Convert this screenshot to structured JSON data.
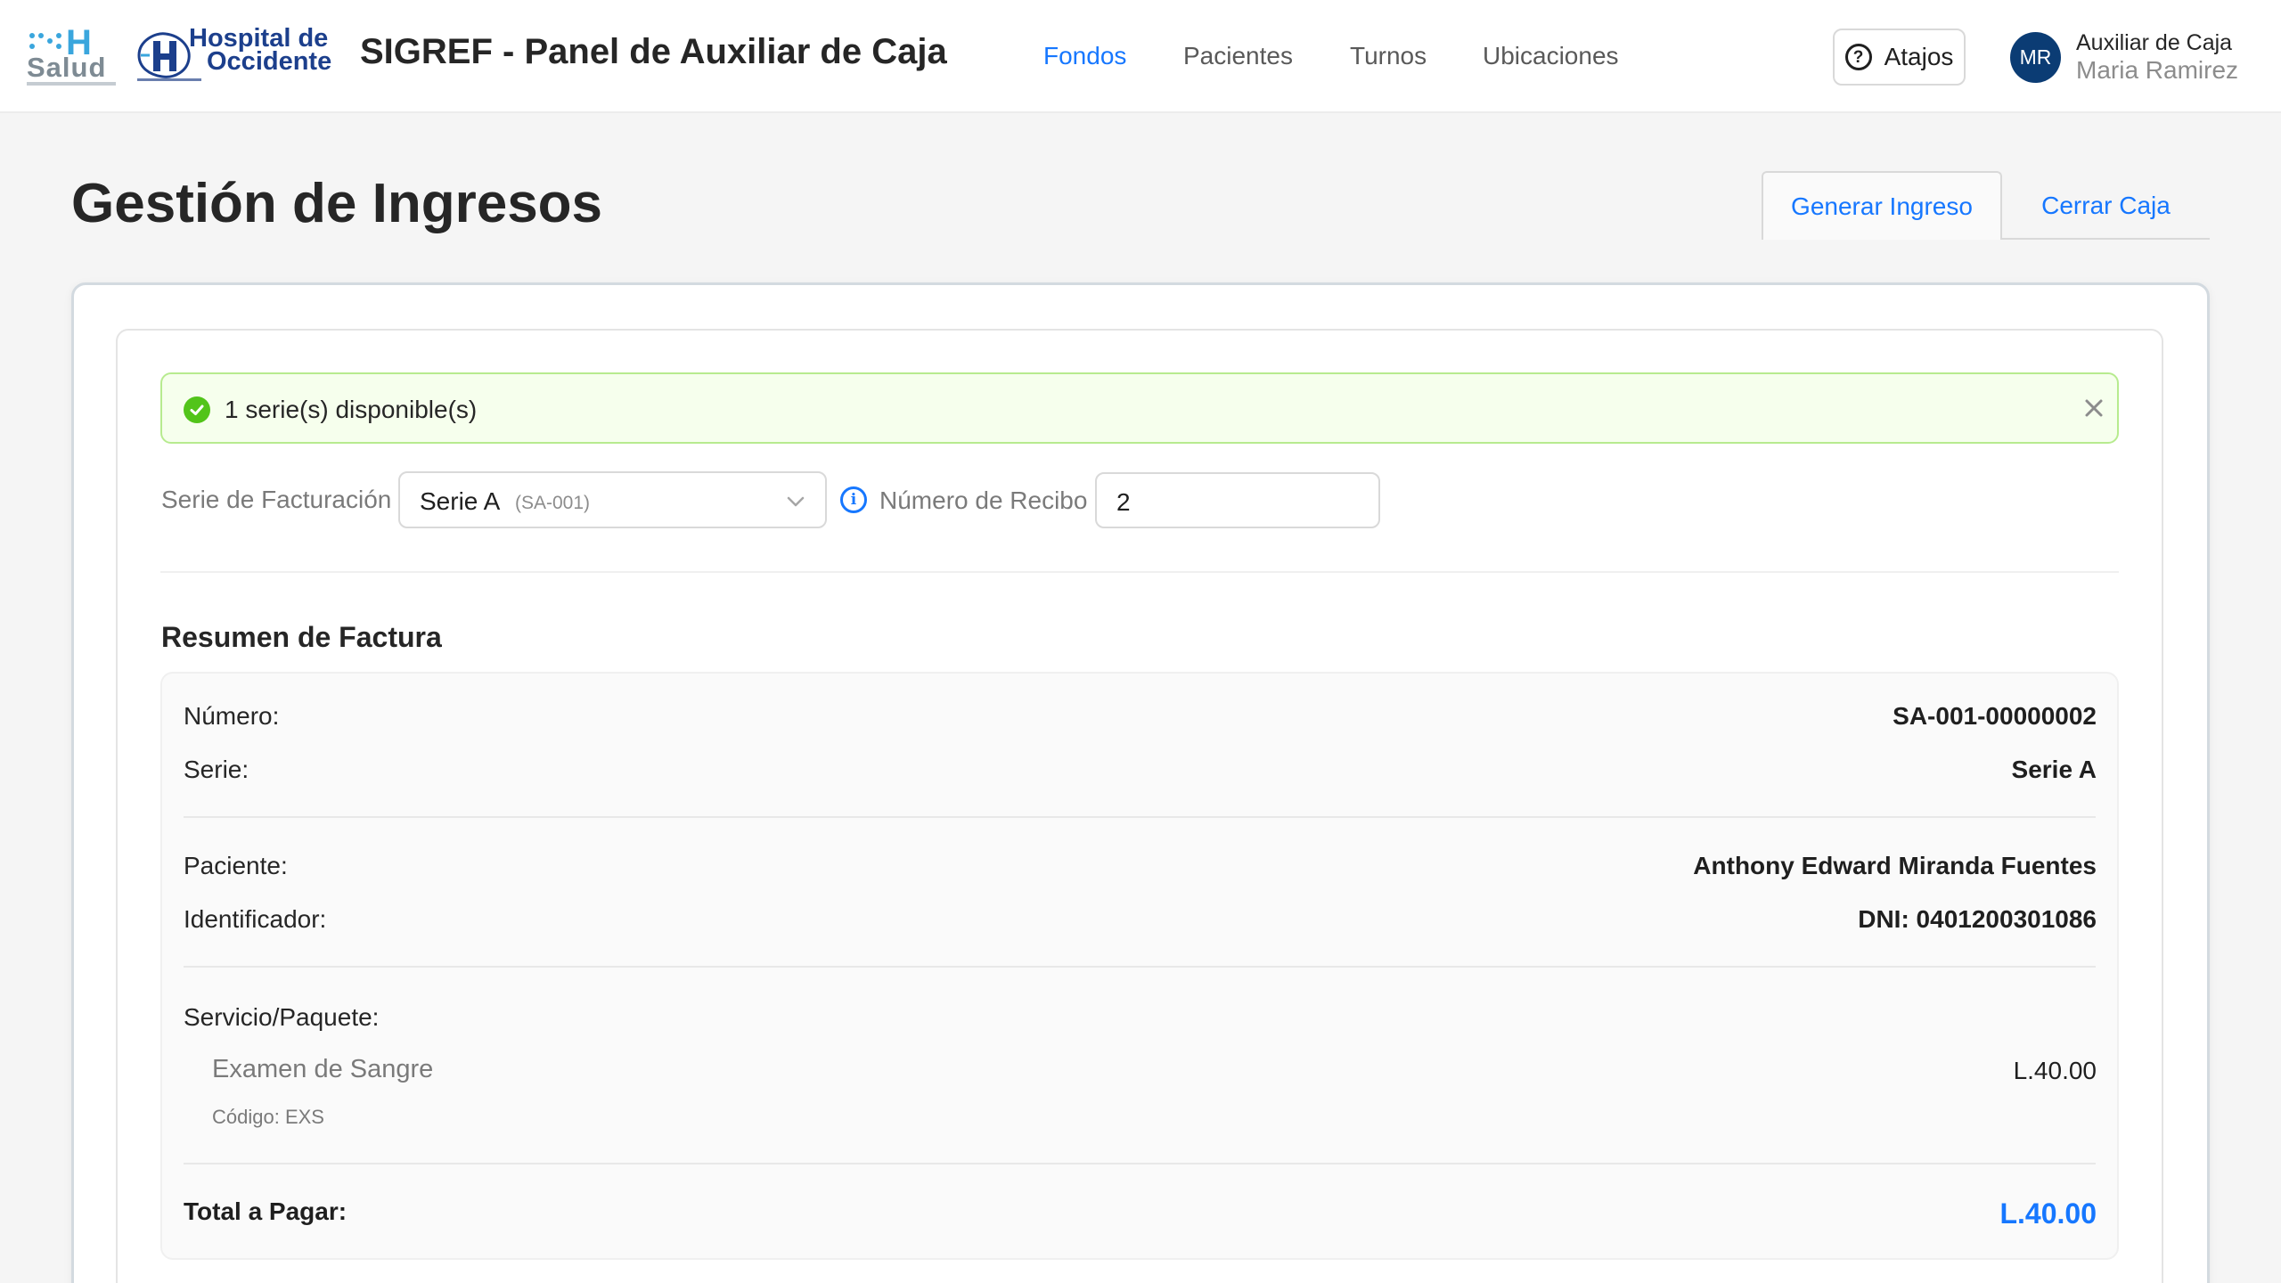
{
  "header": {
    "logo_salud": {
      "letter": "H",
      "word": "Salud"
    },
    "logo_hospital": {
      "line1": "Hospital de",
      "line2": "Occidente"
    },
    "app_title": "SIGREF - Panel de Auxiliar de Caja",
    "nav": [
      {
        "label": "Fondos",
        "active": true
      },
      {
        "label": "Pacientes",
        "active": false
      },
      {
        "label": "Turnos",
        "active": false
      },
      {
        "label": "Ubicaciones",
        "active": false
      }
    ],
    "shortcuts_label": "Atajos",
    "user": {
      "initials": "MR",
      "role": "Auxiliar de Caja",
      "name": "Maria Ramirez"
    }
  },
  "page": {
    "title": "Gestión de Ingresos",
    "tabs": [
      {
        "label": "Generar Ingreso",
        "active": true
      },
      {
        "label": "Cerrar Caja",
        "active": false
      }
    ]
  },
  "alert": {
    "text": "1 serie(s) disponible(s)",
    "type": "success"
  },
  "form": {
    "series_label": "Serie de Facturación",
    "series_value": "Serie A",
    "series_code": "(SA-001)",
    "receipt_label": "Número de Recibo",
    "receipt_value": "2"
  },
  "summary": {
    "title": "Resumen de Factura",
    "number_label": "Número:",
    "number_value": "SA-001-00000002",
    "series_label": "Serie:",
    "series_value": "Serie A",
    "patient_label": "Paciente:",
    "patient_value": "Anthony Edward Miranda Fuentes",
    "identifier_label": "Identificador:",
    "identifier_value": "DNI: 0401200301086",
    "service_label": "Servicio/Paquete:",
    "service_name": "Examen de Sangre",
    "service_code": "Código: EXS",
    "service_price": "L.40.00",
    "total_label": "Total a Pagar:",
    "total_value": "L.40.00"
  },
  "colors": {
    "primary": "#1677ff",
    "success_bg": "#f6ffed",
    "success_border": "#b7eb8f",
    "success_icon": "#52c41a",
    "avatar_bg": "#0b3c74",
    "hospital_blue": "#1c3f8c"
  }
}
